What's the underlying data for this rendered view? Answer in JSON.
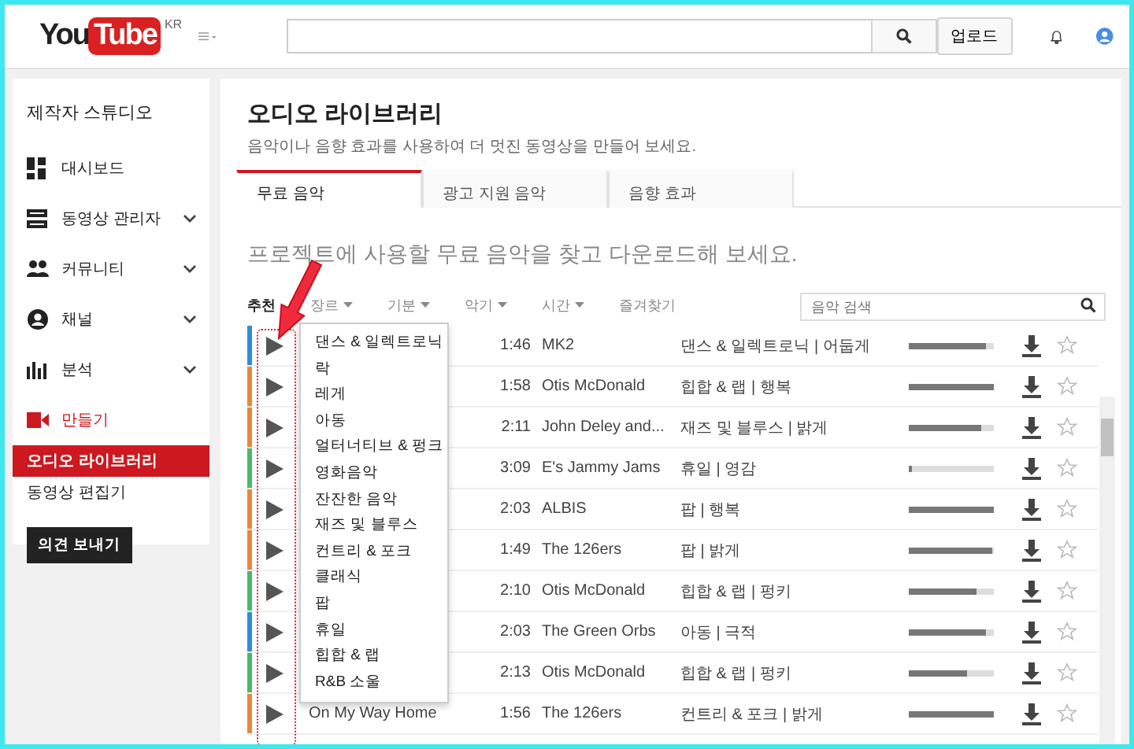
{
  "header": {
    "logo": {
      "you": "You",
      "tube": "Tube",
      "region": "KR"
    },
    "upload_button": "업로드"
  },
  "sidebar": {
    "title": "제작자 스튜디오",
    "items": [
      {
        "label": "대시보드",
        "kind": "link",
        "selected": false
      },
      {
        "label": "동영상 관리자",
        "kind": "menu",
        "selected": false
      },
      {
        "label": "커뮤니티",
        "kind": "menu",
        "selected": false
      },
      {
        "label": "채널",
        "kind": "menu",
        "selected": false
      },
      {
        "label": "분석",
        "kind": "menu",
        "selected": false
      },
      {
        "label": "만들기",
        "kind": "link",
        "selected": true,
        "children": [
          {
            "label": "오디오 라이브러리",
            "selected": true
          },
          {
            "label": "동영상 편집기",
            "selected": false
          }
        ]
      }
    ],
    "feedback_button": "의견 보내기"
  },
  "page": {
    "title": "오디오 라이브러리",
    "subtitle": "음악이나 음향 효과를 사용하여 더 멋진 동영상을 만들어 보세요.",
    "tabs": [
      {
        "label": "무료 음악",
        "selected": true
      },
      {
        "label": "광고 지원 음악",
        "selected": false
      },
      {
        "label": "음향 효과",
        "selected": false
      }
    ],
    "heading": "프로젝트에 사용할 무료 음악을 찾고 다운로드해 보세요.",
    "filters": [
      {
        "label": "추천",
        "kind": "link",
        "selected": true
      },
      {
        "label": "장르",
        "kind": "dropdown",
        "selected": false
      },
      {
        "label": "기분",
        "kind": "dropdown",
        "selected": false
      },
      {
        "label": "악기",
        "kind": "dropdown",
        "selected": false
      },
      {
        "label": "시간",
        "kind": "dropdown",
        "selected": false
      },
      {
        "label": "즐겨찾기",
        "kind": "link",
        "selected": false
      }
    ],
    "search": {
      "placeholder": "음악 검색"
    },
    "tracks": [
      {
        "color": "#2d8fd6",
        "duration": "1:46",
        "artist": "MK2",
        "genre": "댄스 & 일렉트로닉 | 어둡게",
        "level": 0.9,
        "favorite": false
      },
      {
        "color": "#e8873a",
        "duration": "1:58",
        "artist": "Otis McDonald",
        "genre": "힙합 & 랩 | 행복",
        "level": 1.0,
        "favorite": false
      },
      {
        "color": "#e8873a",
        "duration": "2:11",
        "artist": "John Deley and...",
        "genre": "재즈 및 블루스 | 밝게",
        "level": 0.85,
        "favorite": false
      },
      {
        "color": "#4cb86a",
        "duration": "3:09",
        "artist": "E's Jammy Jams",
        "genre": "휴일 | 영감",
        "level": 0.04,
        "favorite": false
      },
      {
        "color": "#e8873a",
        "duration": "2:03",
        "artist": "ALBIS",
        "genre": "팝 | 행복",
        "level": 1.0,
        "favorite": false
      },
      {
        "color": "#e8873a",
        "duration": "1:49",
        "artist": "The 126ers",
        "genre": "팝 | 밝게",
        "level": 0.98,
        "favorite": false
      },
      {
        "color": "#4cb86a",
        "duration": "2:10",
        "artist": "Otis McDonald",
        "genre": "힙합 & 랩 | 펑키",
        "level": 0.8,
        "favorite": false
      },
      {
        "color": "#2d8fd6",
        "duration": "2:03",
        "artist": "The Green Orbs",
        "genre": "아동 | 극적",
        "level": 0.9,
        "favorite": false
      },
      {
        "color": "#4cb86a",
        "duration": "2:13",
        "artist": "Otis McDonald",
        "genre": "힙합 & 랩 | 펑키",
        "level": 0.68,
        "favorite": false
      },
      {
        "color": "#e8873a",
        "title": "On My Way Home",
        "duration": "1:56",
        "artist": "The 126ers",
        "genre": "컨트리 & 포크 | 밝게",
        "level": 1.0,
        "favorite": false
      }
    ],
    "genre_menu": [
      "댄스 & 일렉트로닉",
      "락",
      "레게",
      "아동",
      "얼터너티브 & 펑크",
      "영화음악",
      "잔잔한 음악",
      "재즈 및 블루스",
      "컨트리 & 포크",
      "클래식",
      "팝",
      "휴일",
      "힙합 & 랩",
      "R&B 소울"
    ]
  }
}
